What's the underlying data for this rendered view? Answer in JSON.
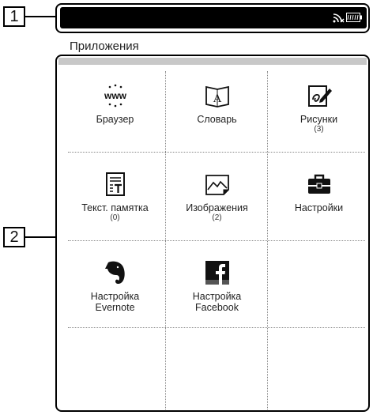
{
  "callouts": {
    "one": "1",
    "two": "2"
  },
  "title": "Приложения",
  "apps": [
    {
      "label": "Браузер",
      "icon": "www-icon",
      "count": ""
    },
    {
      "label": "Словарь",
      "icon": "dictionary-book-icon",
      "count": ""
    },
    {
      "label": "Рисунки",
      "icon": "drawing-pen-icon",
      "count": "(3)"
    },
    {
      "label": "Текст. памятка",
      "icon": "text-note-icon",
      "count": "(0)"
    },
    {
      "label": "Изображения",
      "icon": "image-icon",
      "count": "(2)"
    },
    {
      "label": "Настройки",
      "icon": "toolbox-icon",
      "count": ""
    },
    {
      "label_line1": "Настройка",
      "label_line2": "Evernote",
      "icon": "evernote-elephant-icon"
    },
    {
      "label_line1": "Настройка",
      "label_line2": "Facebook",
      "icon": "facebook-icon"
    }
  ],
  "status_icons": [
    "wifi-off-icon",
    "battery-icon"
  ],
  "colors": {
    "status_bar": "#000000",
    "strip": "#c8c8c8"
  }
}
